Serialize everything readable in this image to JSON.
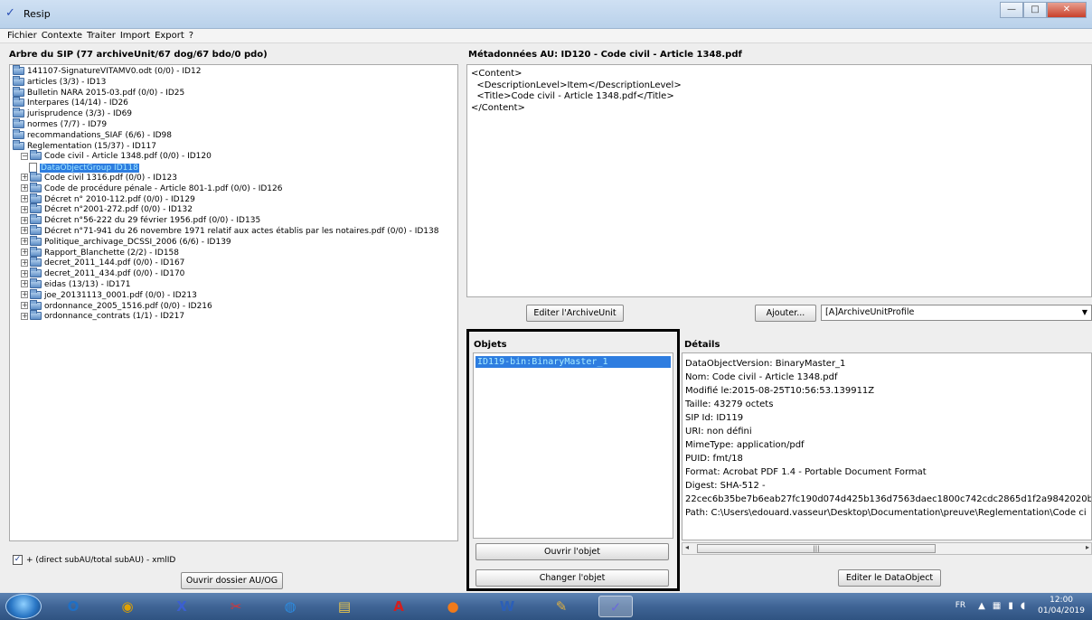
{
  "window": {
    "title": "Resip",
    "minimize": "—",
    "maximize": "□",
    "close": "✕"
  },
  "menu": [
    "Fichier",
    "Contexte",
    "Traiter",
    "Import",
    "Export",
    "?"
  ],
  "left_panel": {
    "title": "Arbre du SIP (77 archiveUnit/67 dog/67 bdo/0 pdo)",
    "tree": [
      {
        "label": "141107-SignatureVITAMV0.odt (0/0) - ID12",
        "level": 0,
        "expander": "",
        "icon": "folder"
      },
      {
        "label": "articles (3/3) - ID13",
        "level": 0,
        "expander": "",
        "icon": "folder"
      },
      {
        "label": "Bulletin NARA 2015-03.pdf (0/0) - ID25",
        "level": 0,
        "expander": "",
        "icon": "folder"
      },
      {
        "label": "Interpares (14/14) - ID26",
        "level": 0,
        "expander": "",
        "icon": "folder"
      },
      {
        "label": "jurisprudence (3/3) - ID69",
        "level": 0,
        "expander": "",
        "icon": "folder"
      },
      {
        "label": "normes (7/7) - ID79",
        "level": 0,
        "expander": "",
        "icon": "folder"
      },
      {
        "label": "recommandations_SIAF (6/6) - ID98",
        "level": 0,
        "expander": "",
        "icon": "folder"
      },
      {
        "label": "Reglementation (15/37) - ID117",
        "level": 0,
        "expander": "",
        "icon": "folder"
      },
      {
        "label": "Code civil - Article 1348.pdf (0/0) - ID120",
        "level": 1,
        "expander": "−",
        "icon": "folder"
      },
      {
        "label": "DataObjectGroup ID118",
        "level": 2,
        "expander": "",
        "icon": "doc",
        "selected": true
      },
      {
        "label": "Code civil 1316.pdf (0/0) - ID123",
        "level": 1,
        "expander": "+",
        "icon": "folder"
      },
      {
        "label": "Code de procédure pénale - Article 801-1.pdf (0/0) - ID126",
        "level": 1,
        "expander": "+",
        "icon": "folder"
      },
      {
        "label": "Décret n° 2010-112.pdf (0/0) - ID129",
        "level": 1,
        "expander": "+",
        "icon": "folder"
      },
      {
        "label": "Décret n°2001-272.pdf (0/0) - ID132",
        "level": 1,
        "expander": "+",
        "icon": "folder"
      },
      {
        "label": "Décret n°56-222 du 29 février 1956.pdf (0/0) - ID135",
        "level": 1,
        "expander": "+",
        "icon": "folder"
      },
      {
        "label": "Décret n°71-941 du 26 novembre 1971 relatif aux actes établis par les notaires.pdf (0/0) - ID138",
        "level": 1,
        "expander": "+",
        "icon": "folder"
      },
      {
        "label": "Politique_archivage_DCSSI_2006 (6/6) - ID139",
        "level": 1,
        "expander": "+",
        "icon": "folder"
      },
      {
        "label": "Rapport_Blanchette (2/2) - ID158",
        "level": 1,
        "expander": "+",
        "icon": "folder"
      },
      {
        "label": "decret_2011_144.pdf (0/0) - ID167",
        "level": 1,
        "expander": "+",
        "icon": "folder"
      },
      {
        "label": "decret_2011_434.pdf (0/0) - ID170",
        "level": 1,
        "expander": "+",
        "icon": "folder"
      },
      {
        "label": "eidas (13/13) - ID171",
        "level": 1,
        "expander": "+",
        "icon": "folder"
      },
      {
        "label": "joe_20131113_0001.pdf (0/0) - ID213",
        "level": 1,
        "expander": "+",
        "icon": "folder"
      },
      {
        "label": "ordonnance_2005_1516.pdf (0/0) - ID216",
        "level": 1,
        "expander": "+",
        "icon": "folder"
      },
      {
        "label": "ordonnance_contrats (1/1) - ID217",
        "level": 1,
        "expander": "+",
        "icon": "folder"
      }
    ],
    "checkbox_label": "+ (direct subAU/total subAU) - xmlID",
    "checkbox_checked": true,
    "open_folder_button": "Ouvrir dossier AU/OG"
  },
  "metadata_panel": {
    "title": "Métadonnées AU: ID120 - Code civil - Article 1348.pdf",
    "content": "<Content>\n  <DescriptionLevel>Item</DescriptionLevel>\n  <Title>Code civil - Article 1348.pdf</Title>\n</Content>",
    "edit_button": "Editer l'ArchiveUnit",
    "add_button": "Ajouter...",
    "add_select_value": "[A]ArchiveUnitProfile"
  },
  "objets_panel": {
    "title": "Objets",
    "items": [
      "ID119-bin:BinaryMaster_1"
    ],
    "open_button": "Ouvrir l'objet",
    "change_button": "Changer l'objet"
  },
  "details_panel": {
    "title": "Détails",
    "lines": [
      "DataObjectVersion: BinaryMaster_1",
      "Nom: Code civil - Article 1348.pdf",
      "Modifié le:2015-08-25T10:56:53.139911Z",
      "Taille: 43279 octets",
      "SIP Id: ID119",
      "URI: non défini",
      "MimeType: application/pdf",
      "PUID: fmt/18",
      "Format: Acrobat PDF 1.4 - Portable Document Format",
      "Digest: SHA-512 -",
      "22cec6b35be7b6eab27fc190d074d425b136d7563daec1800c742cdc2865d1f2a9842020b5c",
      "Path: C:\\Users\\edouard.vasseur\\Desktop\\Documentation\\preuve\\Reglementation\\Code ci"
    ],
    "edit_button": "Editer le DataObject"
  },
  "taskbar": {
    "language": "FR",
    "time": "12:00",
    "date": "01/04/2019",
    "apps": [
      {
        "name": "outlook-icon",
        "glyph": "O",
        "color": "#1f6fc5"
      },
      {
        "name": "chrome-icon",
        "glyph": "◉",
        "color": "#e0a100"
      },
      {
        "name": "xmind-icon",
        "glyph": "X",
        "color": "#3b5fd1"
      },
      {
        "name": "snipping-tool-icon",
        "glyph": "✂",
        "color": "#d33"
      },
      {
        "name": "network-icon",
        "glyph": "◍",
        "color": "#2b8be0"
      },
      {
        "name": "file-explorer-icon",
        "glyph": "▤",
        "color": "#e8c44c"
      },
      {
        "name": "acrobat-icon",
        "glyph": "A",
        "color": "#d21f1f"
      },
      {
        "name": "firefox-icon",
        "glyph": "●",
        "color": "#f07a1a"
      },
      {
        "name": "word-icon",
        "glyph": "W",
        "color": "#2b5fb8"
      },
      {
        "name": "paint-icon",
        "glyph": "✎",
        "color": "#e0b040"
      },
      {
        "name": "resip-icon",
        "glyph": "✓",
        "color": "#6a6adc",
        "active": true
      }
    ]
  }
}
